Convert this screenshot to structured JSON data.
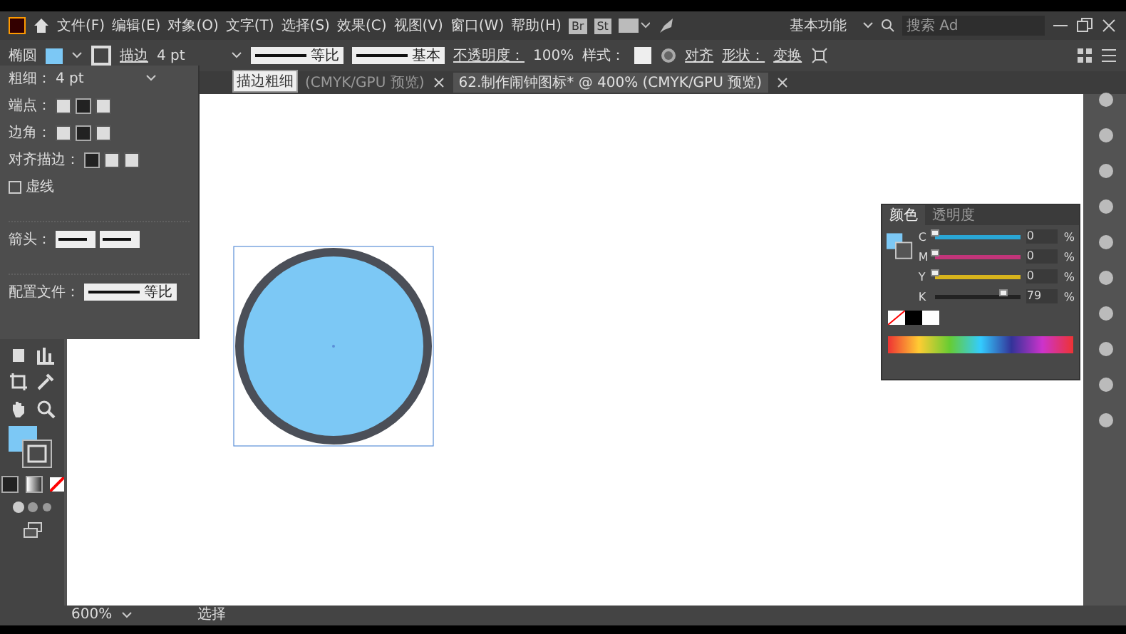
{
  "menu_bar": {
    "items": [
      "文件(F)",
      "编辑(E)",
      "对象(O)",
      "文字(T)",
      "选择(S)",
      "效果(C)",
      "视图(V)",
      "窗口(W)",
      "帮助(H)"
    ],
    "badges": [
      "Br",
      "St"
    ],
    "workspace": "基本功能",
    "search": {
      "placeholder": "搜索 Ad"
    }
  },
  "control_bar": {
    "object_label": "椭圆",
    "stroke_link": "描边",
    "stroke_weight": "4 pt",
    "profile": "等比",
    "brush": "基本",
    "opacity_label": "不透明度：",
    "opacity": "100%",
    "style_label": "样式：",
    "align_link": "对齐",
    "shape_link": "形状：",
    "transform_link": "变换",
    "tooltip": "描边粗细"
  },
  "tabs": [
    {
      "label": "(CMYK/GPU 预览)",
      "selected": false
    },
    {
      "label": "62.制作闹钟图标* @ 400% (CMYK/GPU 预览)",
      "selected": true
    }
  ],
  "stroke_panel": {
    "weight_label": "粗细：",
    "weight": "4 pt",
    "cap_label": "端点：",
    "corner_label": "边角：",
    "align_label": "对齐描边：",
    "dashed": {
      "label": "虚线",
      "checked": false
    },
    "arrow_label": "箭头：",
    "profile_label": "配置文件：",
    "profile": "等比"
  },
  "color_panel": {
    "tabs": [
      {
        "label": "颜色",
        "selected": true
      },
      {
        "label": "透明度",
        "selected": false
      }
    ],
    "channels": [
      {
        "name": "C",
        "level": 0,
        "value": "0",
        "unit": "%",
        "color": "#2aa7d6"
      },
      {
        "name": "M",
        "level": 0,
        "value": "0",
        "unit": "%",
        "color": "#c2357a"
      },
      {
        "name": "Y",
        "level": 0,
        "value": "0",
        "unit": "%",
        "color": "#d8b41c"
      },
      {
        "name": "K",
        "level": 0.79,
        "value": "79",
        "unit": "%",
        "color": "#222222"
      }
    ]
  },
  "status_bar": {
    "zoom": "600%",
    "tool": "选择"
  }
}
